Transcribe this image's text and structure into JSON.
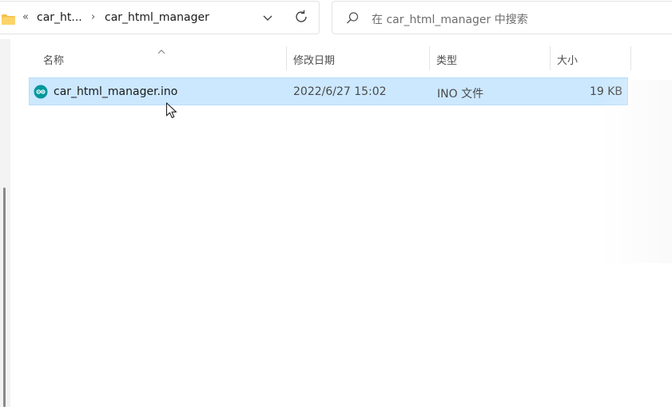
{
  "breadcrumb": {
    "more_glyph": "«",
    "separator": "›",
    "items": [
      "car_ht...",
      "car_html_manager"
    ]
  },
  "search": {
    "placeholder": "在 car_html_manager 中搜索"
  },
  "columns": {
    "name": "名称",
    "modified": "修改日期",
    "type": "类型",
    "size": "大小"
  },
  "files": [
    {
      "name": "car_html_manager.ino",
      "modified": "2022/6/27 15:02",
      "type": "INO 文件",
      "size": "19 KB",
      "selected": true
    }
  ],
  "icons": {
    "folder": "folder-icon",
    "dropdown": "chevron-down-icon",
    "refresh": "refresh-icon",
    "search": "search-icon",
    "file": "arduino-file-icon",
    "sort": "sort-ascending-icon",
    "cursor": "mouse-pointer-icon"
  },
  "colors": {
    "selection": "#cce8ff",
    "selection_border": "#b9dcf9",
    "folder": "#f5c24b",
    "arduino": "#00979c"
  }
}
